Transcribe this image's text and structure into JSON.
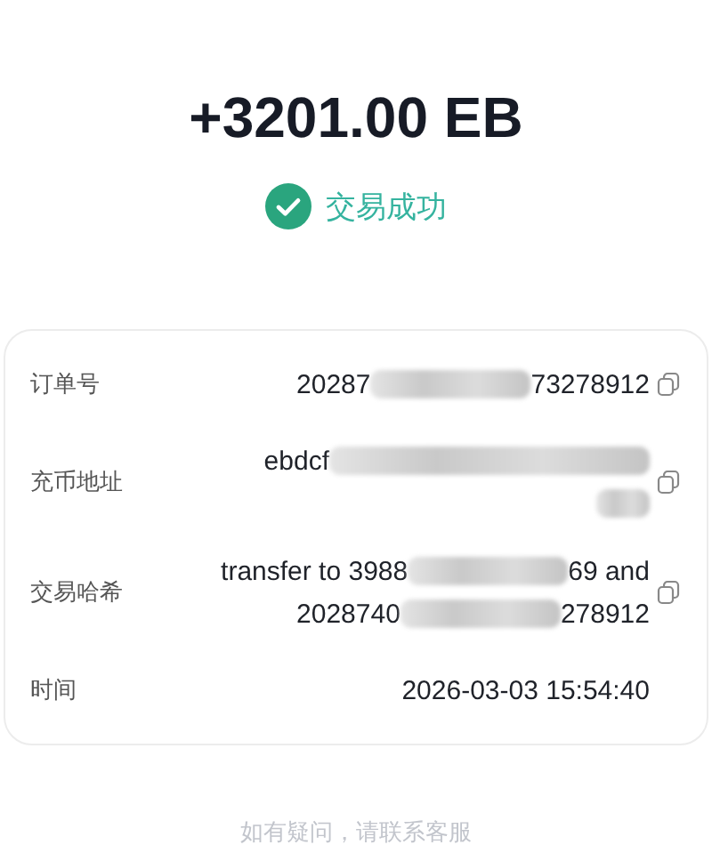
{
  "amount": "+3201.00 EB",
  "status": {
    "text": "交易成功",
    "success": true
  },
  "details": [
    {
      "label": "订单号",
      "copyable": true,
      "lines": [
        [
          {
            "kind": "text",
            "text": "20287"
          },
          {
            "kind": "blur"
          },
          {
            "kind": "text",
            "text": "73278912"
          }
        ]
      ]
    },
    {
      "label": "充币地址",
      "copyable": true,
      "lines": [
        [
          {
            "kind": "text",
            "text": "ebdcf"
          },
          {
            "kind": "blur"
          }
        ],
        [
          {
            "kind": "blur"
          }
        ]
      ]
    },
    {
      "label": "交易哈希",
      "copyable": true,
      "lines": [
        [
          {
            "kind": "text",
            "text": "transfer to 3988"
          },
          {
            "kind": "blur"
          },
          {
            "kind": "text",
            "text": "69 and"
          }
        ],
        [
          {
            "kind": "text",
            "text": "2028740"
          },
          {
            "kind": "blur"
          },
          {
            "kind": "text",
            "text": "278912"
          }
        ]
      ]
    },
    {
      "label": "时间",
      "copyable": false,
      "lines": [
        [
          {
            "kind": "text",
            "text": "2026-03-03 15:54:40"
          }
        ]
      ]
    }
  ],
  "footer": "如有疑问，请联系客服"
}
